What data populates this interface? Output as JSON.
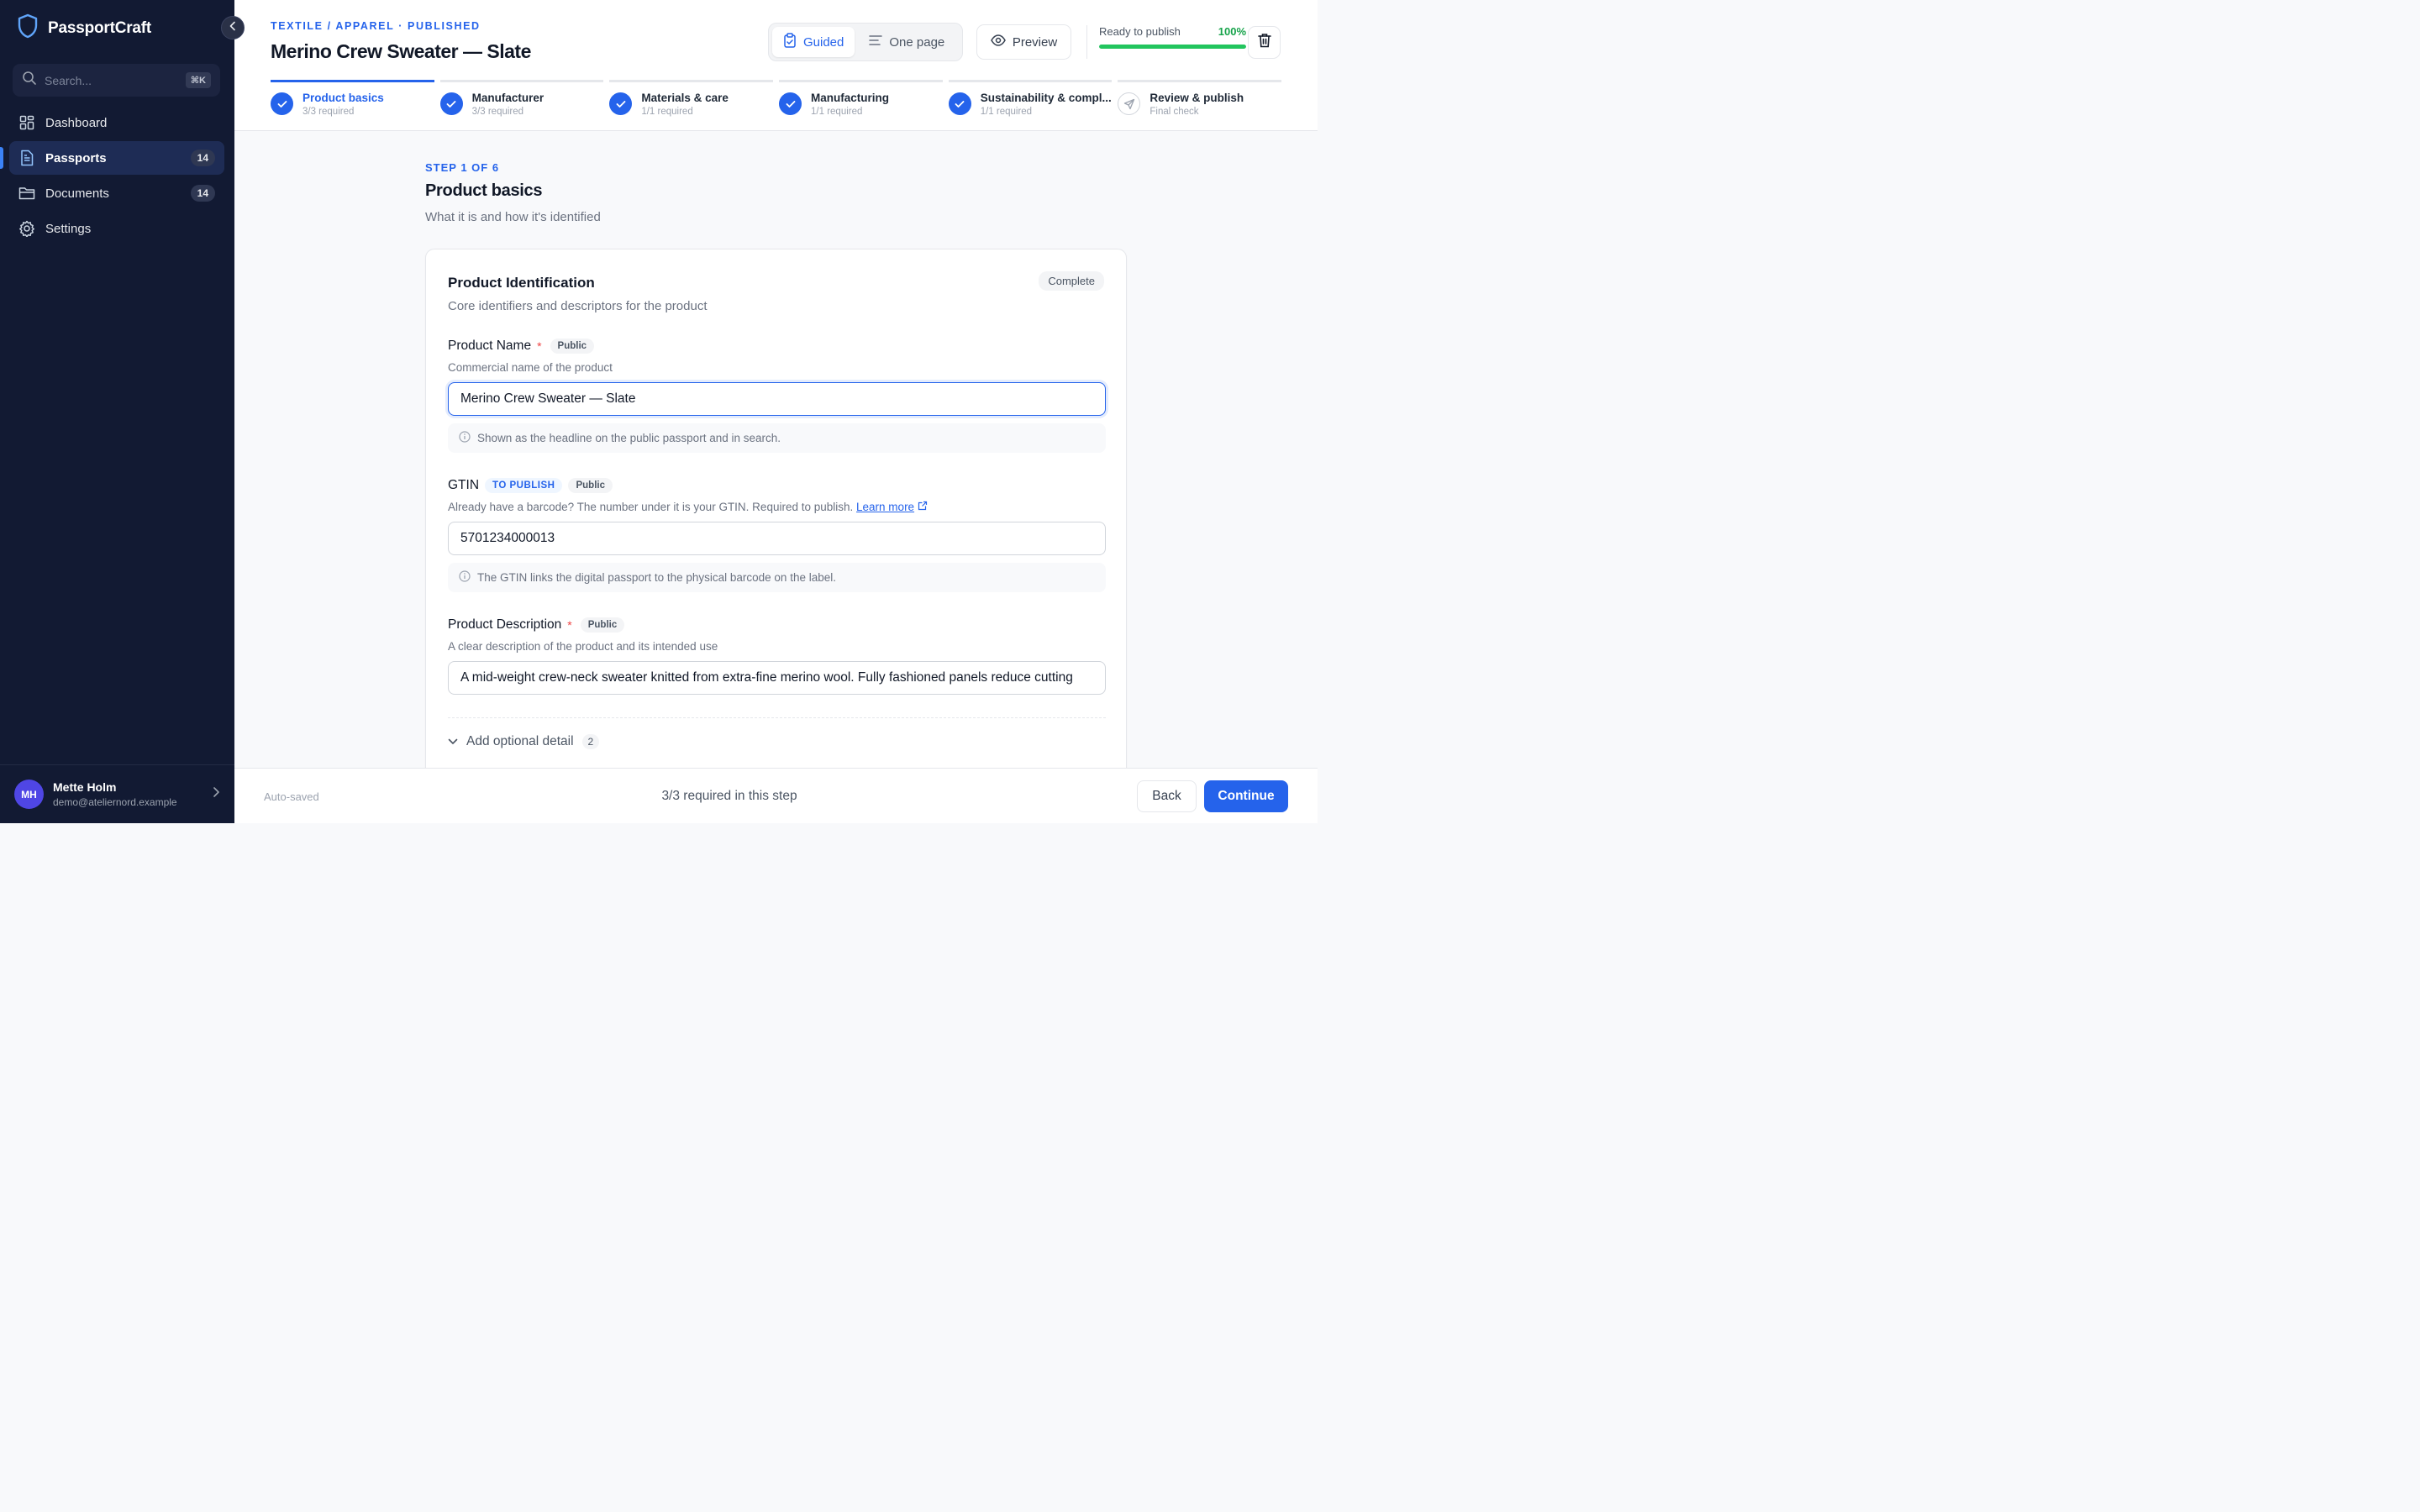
{
  "app": {
    "name": "PassportCraft"
  },
  "search": {
    "placeholder": "Search...",
    "shortcut": "⌘K"
  },
  "nav": [
    {
      "label": "Dashboard",
      "icon": "grid-icon",
      "badge": ""
    },
    {
      "label": "Passports",
      "icon": "document-icon",
      "badge": "14",
      "active": true
    },
    {
      "label": "Documents",
      "icon": "folder-icon",
      "badge": "14"
    },
    {
      "label": "Settings",
      "icon": "gear-icon",
      "badge": ""
    }
  ],
  "user": {
    "initials": "MH",
    "name": "Mette Holm",
    "email": "demo@ateliernord.example"
  },
  "header": {
    "eyebrow": "TEXTILE / APPAREL · PUBLISHED",
    "title": "Merino Crew Sweater — Slate",
    "mode_guided": "Guided",
    "mode_onepage": "One page",
    "preview": "Preview",
    "ready_label": "Ready to publish",
    "ready_pct": "100%",
    "ready_value": 1.0
  },
  "steps": [
    {
      "name": "Product basics",
      "sub": "3/3 required",
      "state": "done"
    },
    {
      "name": "Manufacturer",
      "sub": "3/3 required",
      "state": "done"
    },
    {
      "name": "Materials & care",
      "sub": "1/1 required",
      "state": "done"
    },
    {
      "name": "Manufacturing",
      "sub": "1/1 required",
      "state": "done"
    },
    {
      "name": "Sustainability & compl...",
      "sub": "1/1 required",
      "state": "done"
    },
    {
      "name": "Review & publish",
      "sub": "Final check",
      "state": "pending"
    }
  ],
  "main": {
    "step_eyebrow": "STEP 1 OF 6",
    "step_title": "Product basics",
    "step_desc": "What it is and how it's identified"
  },
  "card": {
    "title": "Product Identification",
    "subtitle": "Core identifiers and descriptors for the product",
    "status": "Complete",
    "fields": {
      "name": {
        "label": "Product Name",
        "required": "*",
        "visibility": "Public",
        "help": "Commercial name of the product",
        "value": "Merino Crew Sweater — Slate",
        "hint": "Shown as the headline on the public passport and in search."
      },
      "gtin": {
        "label": "GTIN",
        "tag": "TO PUBLISH",
        "visibility": "Public",
        "help": "Already have a barcode? The number under it is your GTIN. Required to publish.",
        "link": "Learn more",
        "value": "5701234000013",
        "hint": "The GTIN links the digital passport to the physical barcode on the label."
      },
      "description": {
        "label": "Product Description",
        "required": "*",
        "visibility": "Public",
        "help": "A clear description of the product and its intended use",
        "value": "A mid-weight crew-neck sweater knitted from extra-fine merino wool. Fully fashioned panels reduce cutting"
      }
    },
    "optional_label": "Add optional detail",
    "optional_count": "2"
  },
  "footer": {
    "autosave": "Auto-saved",
    "required_status": "3/3 required in this step",
    "back": "Back",
    "continue": "Continue"
  },
  "colors": {
    "accent": "#2563eb",
    "sidebar": "#121a33",
    "success": "#22c55e"
  }
}
